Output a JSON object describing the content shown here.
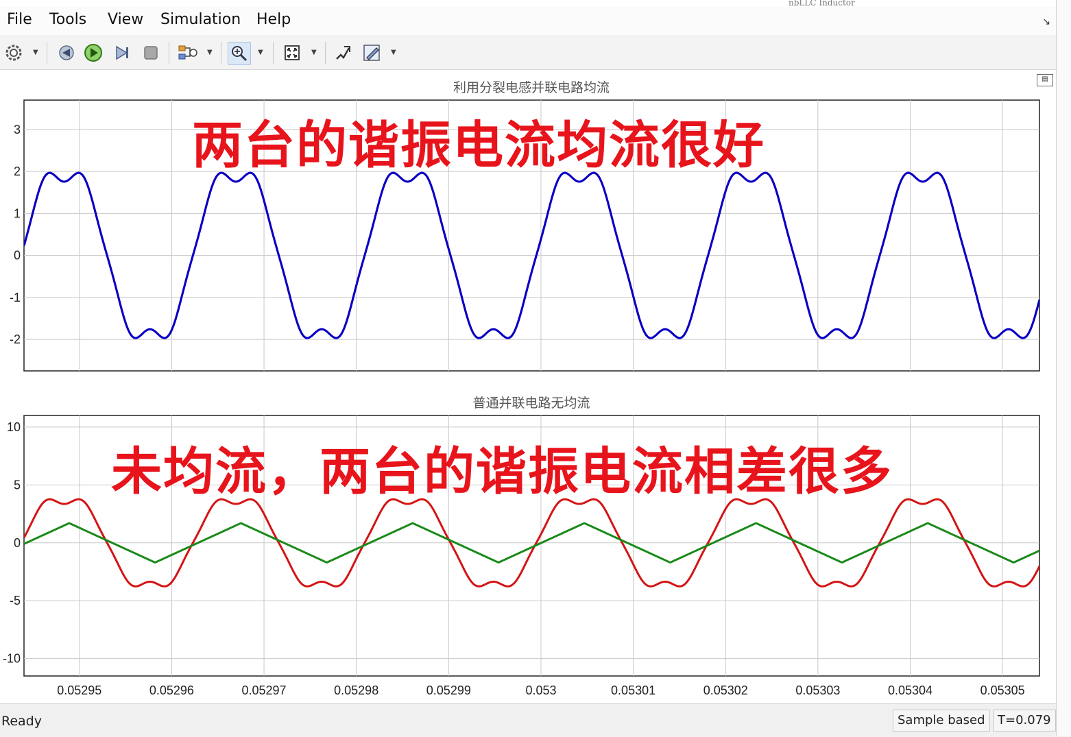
{
  "window": {
    "behind_title": "nbLLC Inductor"
  },
  "menu": [
    "File",
    "Tools",
    "View",
    "Simulation",
    "Help"
  ],
  "toolbar": {
    "settings": "gear-icon",
    "step_back": "step-back-icon",
    "run": "run-icon",
    "step_forward": "step-forward-icon",
    "stop": "stop-icon",
    "highlight": "highlight-block-icon",
    "zoom": "zoom-in-icon",
    "autoscale": "autoscale-icon",
    "cursor_measure": "cursor-measure-icon",
    "style": "style-pencil-icon"
  },
  "plots": {
    "top": {
      "title": "利用分裂电感并联电路均流",
      "yticks": [
        "3",
        "2",
        "1",
        "0",
        "-1",
        "-2"
      ]
    },
    "bottom": {
      "title": "普通并联电路无均流",
      "yticks": [
        "10",
        "5",
        "0",
        "-5",
        "-10"
      ]
    },
    "xticks": [
      "0.05295",
      "0.05296",
      "0.05297",
      "0.05298",
      "0.05299",
      "0.053",
      "0.05301",
      "0.05302",
      "0.05303",
      "0.05304",
      "0.05305"
    ]
  },
  "annotations": {
    "top": "两台的谐振电流均流很好",
    "bottom": "未均流，两台的谐振电流相差很多"
  },
  "status": {
    "ready": "Ready",
    "mode": "Sample based",
    "time": "T=0.079"
  },
  "colors": {
    "blue_trace": "#0000cc",
    "red_trace": "#d41414",
    "green_trace": "#1a8a1a",
    "annotation": "#e8141c"
  },
  "chart_data": [
    {
      "type": "line",
      "title": "利用分裂电感并联电路均流",
      "xlim": [
        0.052944,
        0.053054
      ],
      "ylim": [
        -2.75,
        3.7
      ],
      "period": 1.86e-05,
      "series": [
        {
          "color": "#d41414",
          "shape": "resonant",
          "amplitude": 2.25,
          "phase": 8.1e-06
        },
        {
          "color": "#0000cc",
          "shape": "resonant",
          "amplitude": 2.25,
          "phase": 8.1e-06
        }
      ]
    },
    {
      "type": "line",
      "title": "普通并联电路无均流",
      "xlim": [
        0.052944,
        0.053054
      ],
      "ylim": [
        -11.5,
        11
      ],
      "period": 1.86e-05,
      "series": [
        {
          "color": "#d41414",
          "shape": "resonant",
          "amplitude": 4.3,
          "phase": 8.1e-06
        },
        {
          "color": "#1a8a1a",
          "shape": "triangle",
          "amplitude": 1.7,
          "phase": 1.33e-05
        }
      ]
    }
  ]
}
